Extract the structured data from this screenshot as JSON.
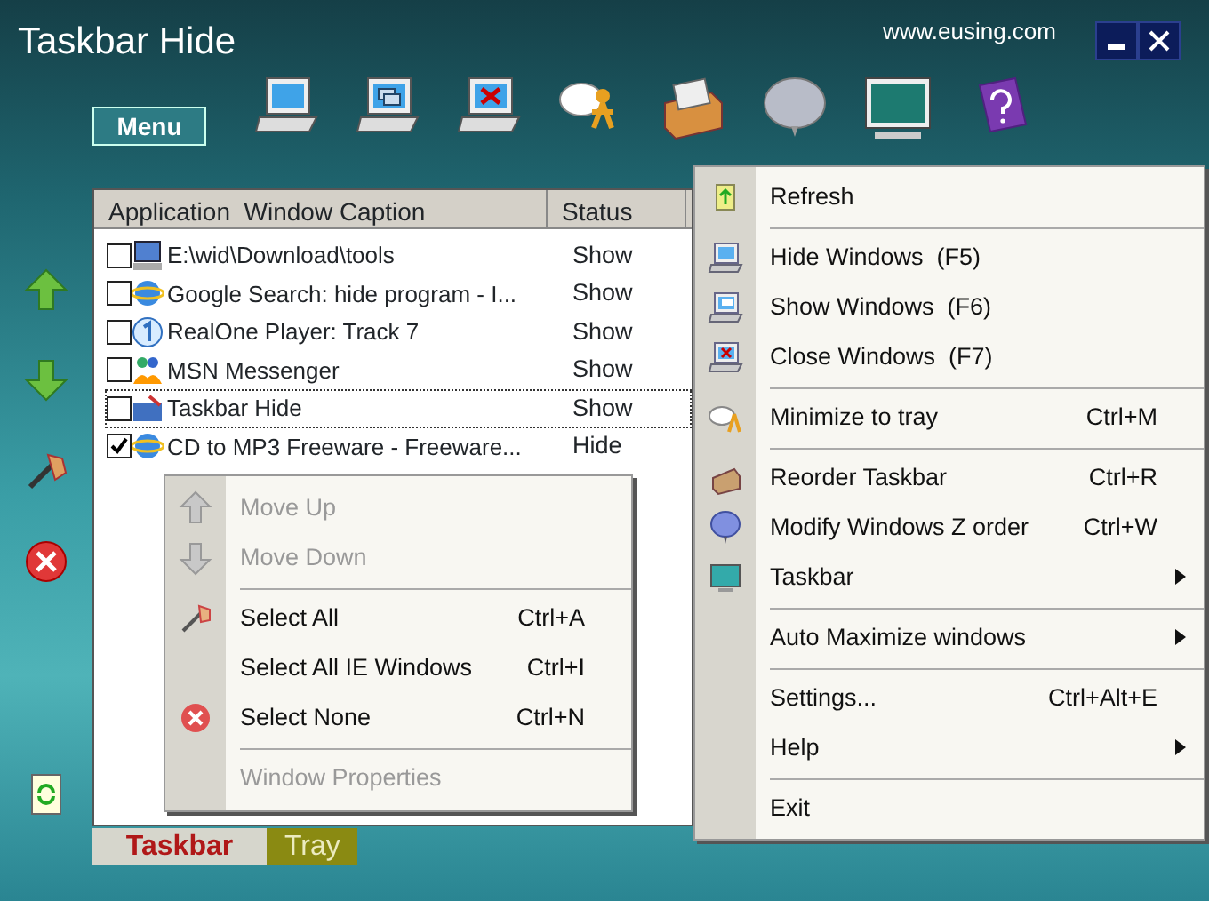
{
  "window": {
    "title": "Taskbar Hide",
    "website": "www.eusing.com"
  },
  "menu_button": {
    "label": "Menu"
  },
  "list": {
    "columns": [
      "Application  Window Caption",
      "Status"
    ],
    "rows": [
      {
        "caption": "E:\\wid\\Download\\tools",
        "status": "Show",
        "checked": false,
        "selected": false
      },
      {
        "caption": "Google Search: hide program - I...",
        "status": "Show",
        "checked": false,
        "selected": false
      },
      {
        "caption": "RealOne Player: Track 7",
        "status": "Show",
        "checked": false,
        "selected": false
      },
      {
        "caption": "MSN Messenger",
        "status": "Show",
        "checked": false,
        "selected": false
      },
      {
        "caption": "Taskbar Hide",
        "status": "Show",
        "checked": false,
        "selected": true
      },
      {
        "caption": "CD to MP3 Freeware - Freeware...",
        "status": "Hide",
        "checked": true,
        "selected": false
      }
    ]
  },
  "tabs": [
    {
      "label": "Taskbar",
      "selected": true
    },
    {
      "label": "Tray",
      "selected": false
    }
  ],
  "list_menu": {
    "items": [
      {
        "kind": "item",
        "label": "Move Up",
        "disabled": true
      },
      {
        "kind": "item",
        "label": "Move Down",
        "disabled": true
      },
      {
        "kind": "separator"
      },
      {
        "kind": "item",
        "label": "Select All",
        "shortcut": "Ctrl+A",
        "disabled": false
      },
      {
        "kind": "item",
        "label": "Select All IE Windows",
        "shortcut": "Ctrl+I",
        "disabled": false
      },
      {
        "kind": "item",
        "label": "Select None",
        "shortcut": "Ctrl+N",
        "disabled": false
      },
      {
        "kind": "separator"
      },
      {
        "kind": "item",
        "label": "Window Properties",
        "disabled": true
      }
    ]
  },
  "main_menu": {
    "items": [
      {
        "kind": "item",
        "label": "Refresh",
        "disabled": false,
        "submenu": false
      },
      {
        "kind": "separator"
      },
      {
        "kind": "item",
        "label": "Hide Windows  (F5)",
        "disabled": false,
        "submenu": false
      },
      {
        "kind": "item",
        "label": "Show Windows  (F6)",
        "disabled": false,
        "submenu": false
      },
      {
        "kind": "item",
        "label": "Close Windows  (F7)",
        "disabled": false,
        "submenu": false
      },
      {
        "kind": "separator"
      },
      {
        "kind": "item",
        "label": "Minimize to tray",
        "shortcut": "Ctrl+M",
        "disabled": false,
        "submenu": false
      },
      {
        "kind": "separator"
      },
      {
        "kind": "item",
        "label": "Reorder Taskbar",
        "shortcut": "Ctrl+R",
        "disabled": false,
        "submenu": false
      },
      {
        "kind": "item",
        "label": "Modify Windows Z order",
        "shortcut": "Ctrl+W",
        "disabled": false,
        "submenu": false
      },
      {
        "kind": "item",
        "label": "Taskbar",
        "disabled": false,
        "submenu": true
      },
      {
        "kind": "separator"
      },
      {
        "kind": "item",
        "label": "Auto Maximize windows",
        "disabled": false,
        "submenu": true
      },
      {
        "kind": "separator"
      },
      {
        "kind": "item",
        "label": "Settings...",
        "shortcut": "Ctrl+Alt+E",
        "disabled": false,
        "submenu": false
      },
      {
        "kind": "item",
        "label": "Help",
        "disabled": false,
        "submenu": true
      },
      {
        "kind": "separator"
      },
      {
        "kind": "item",
        "label": "Exit",
        "disabled": false,
        "submenu": false
      }
    ]
  }
}
